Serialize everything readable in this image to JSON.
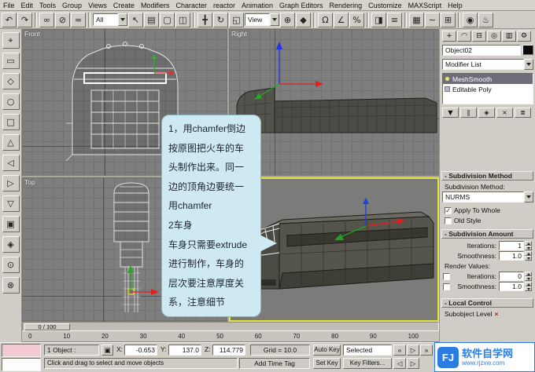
{
  "menu": {
    "items": [
      "File",
      "Edit",
      "Tools",
      "Group",
      "Views",
      "Create",
      "Modifiers",
      "Character",
      "reactor",
      "Animation",
      "Graph Editors",
      "Rendering",
      "Customize",
      "MAXScript",
      "Help"
    ]
  },
  "toolbar": {
    "all_value": "All",
    "view_value": "View",
    "icons": {
      "undo": "↶",
      "redo": "↷",
      "link": "∞",
      "unlink": "⊘",
      "bind": "≈",
      "select": "↖",
      "select_by_name": "▤",
      "region": "▢",
      "crossing": "◫",
      "move": "╋",
      "rotate": "↻",
      "scale": "◱",
      "pivot": "⊕",
      "manipulate": "◆",
      "snap": "Ω",
      "angle_snap": "∠",
      "percent_snap": "%",
      "mirror": "◨",
      "align": "≡",
      "layers": "▦",
      "curve_editor": "∼",
      "schematic": "⊞",
      "material": "◉",
      "render": "♨"
    }
  },
  "left_toolbar": {
    "glyphs": [
      "⌖",
      "▭",
      "◇",
      "○",
      "□",
      "△",
      "◁",
      "▷",
      "▽",
      "▣",
      "◈",
      "⊙",
      "⊗"
    ]
  },
  "viewports": {
    "front": "Front",
    "right": "Right",
    "top": "Top"
  },
  "callout": {
    "lines": [
      "1，用chamfer倒边",
      "按原图把火车的车",
      "头制作出来。同一",
      "边的顶角边要统一",
      "用chamfer",
      "2车身",
      "车身只需要extrude",
      "进行制作，车身的",
      "层次要注意厚度关",
      "系，注意细节"
    ]
  },
  "command_panel": {
    "tab_glyphs": [
      "+",
      "◠",
      "⊟",
      "◎",
      "▥",
      "⚙"
    ],
    "object_name": "Object02",
    "modifier_list_label": "Modifier List",
    "stack_item_1": "MeshSmooth",
    "stack_item_2": "Editable Poly",
    "stack_button_glyphs": [
      "▼",
      "∥",
      "◈",
      "×",
      "≣"
    ],
    "subdivision_method": {
      "title": "- Subdivision Method",
      "method_label": "Subdivision Method:",
      "method_value": "NURMS",
      "apply_label": "Apply To Whole",
      "apply_checked": "✓",
      "old_style_label": "Old Style",
      "old_style_checked": ""
    },
    "subdivision_amount": {
      "title": "- Subdivision Amount",
      "iterations_label": "Iterations:",
      "iterations_value": "1",
      "smoothness_label": "Smoothness:",
      "smoothness_value": "1.0",
      "render_values_label": "Render Values:",
      "render_iterations_label": "Iterations:",
      "render_iterations_value": "0",
      "render_iterations_checked": "",
      "render_smoothness_label": "Smoothness:",
      "render_smoothness_value": "1.0",
      "render_smoothness_checked": ""
    },
    "local_control": {
      "title": "- Local Control",
      "subobject_label": "Subobject Level",
      "subobject_icon_glyph": "×"
    }
  },
  "timeline": {
    "slider": "0 / 100",
    "ticks": [
      "0",
      "10",
      "20",
      "30",
      "40",
      "50",
      "60",
      "70",
      "80",
      "90",
      "100"
    ]
  },
  "status_bar": {
    "object_count": "1 Object :",
    "lock_glyph": "▣",
    "x_label": "X:",
    "x_value": "-0.653",
    "y_label": "Y:",
    "y_value": "137.0",
    "z_label": "Z:",
    "z_value": "114.779",
    "grid_label": "Grid = 10.0",
    "prompt": "Click and drag to select and move objects",
    "time_tag": "Add Time Tag",
    "auto_key": "Auto Key",
    "selected_mode": "Selected",
    "set_key": "Set Key",
    "key_filters": "Key Filters...",
    "transport_row1": [
      "«",
      "▷",
      "»"
    ],
    "transport_row2": [
      "◁",
      "▷"
    ]
  },
  "watermark": {
    "logo": "FJ",
    "title": "软件自学网",
    "url": "www.rjzxw.com"
  }
}
